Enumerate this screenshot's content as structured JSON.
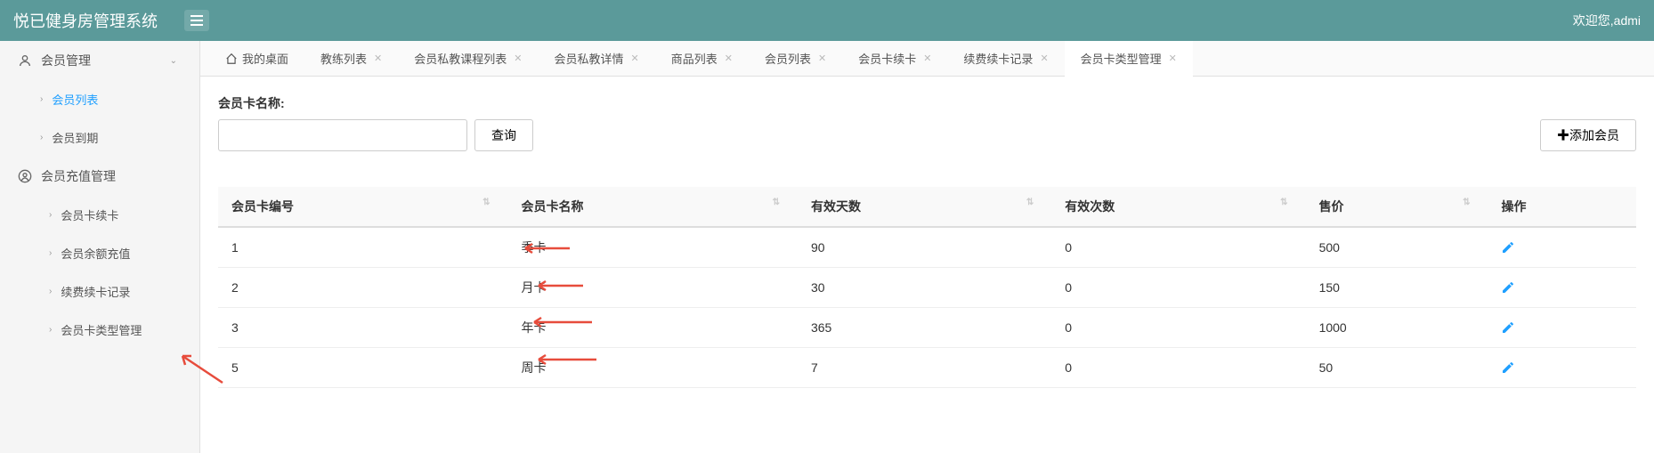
{
  "header": {
    "logo": "悦已健身房管理系统",
    "welcome": "欢迎您,admi"
  },
  "sidebar": {
    "items": [
      {
        "label": "会员管理",
        "type": "group",
        "icon": "user"
      },
      {
        "label": "会员列表",
        "type": "sub",
        "active": true
      },
      {
        "label": "会员到期",
        "type": "sub"
      },
      {
        "label": "会员充值管理",
        "type": "group",
        "icon": "circle-user"
      },
      {
        "label": "会员卡续卡",
        "type": "sub2"
      },
      {
        "label": "会员余额充值",
        "type": "sub2"
      },
      {
        "label": "续费续卡记录",
        "type": "sub2"
      },
      {
        "label": "会员卡类型管理",
        "type": "sub2"
      }
    ]
  },
  "tabs": [
    {
      "label": "我的桌面",
      "home": true
    },
    {
      "label": "教练列表"
    },
    {
      "label": "会员私教课程列表"
    },
    {
      "label": "会员私教详情"
    },
    {
      "label": "商品列表"
    },
    {
      "label": "会员列表"
    },
    {
      "label": "会员卡续卡"
    },
    {
      "label": "续费续卡记录"
    },
    {
      "label": "会员卡类型管理",
      "active": true
    }
  ],
  "query": {
    "label": "会员卡名称:",
    "button": "查询",
    "add_button": "添加会员"
  },
  "table": {
    "headers": [
      "会员卡编号",
      "会员卡名称",
      "有效天数",
      "有效次数",
      "售价",
      "操作"
    ],
    "rows": [
      {
        "id": "1",
        "name": "季卡",
        "days": "90",
        "times": "0",
        "price": "500"
      },
      {
        "id": "2",
        "name": "月卡",
        "days": "30",
        "times": "0",
        "price": "150"
      },
      {
        "id": "3",
        "name": "年卡",
        "days": "365",
        "times": "0",
        "price": "1000"
      },
      {
        "id": "5",
        "name": "周卡",
        "days": "7",
        "times": "0",
        "price": "50"
      }
    ]
  }
}
